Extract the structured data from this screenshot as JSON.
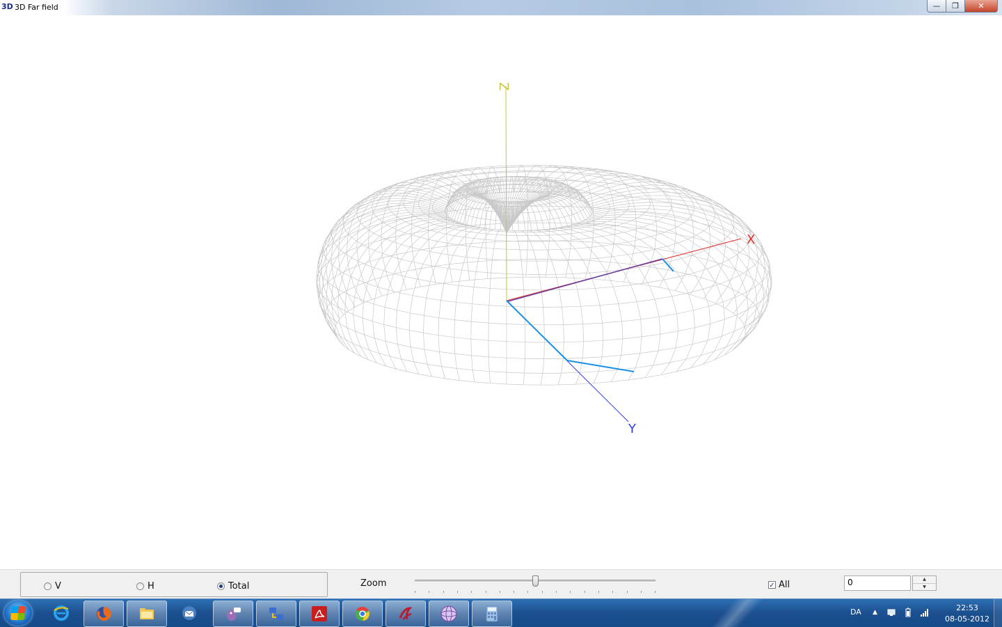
{
  "window": {
    "icon_text": "3D",
    "title": "3D Far field",
    "controls": {
      "minimize": "—",
      "maximize": "❐",
      "close": "✕"
    }
  },
  "viewport": {
    "axes": {
      "x_label": "X",
      "y_label": "Y",
      "z_label": "Z"
    },
    "colors": {
      "mesh": "#c8c8c8",
      "x_axis": "#e23030",
      "y_axis": "#2a3cf0",
      "z_axis": "#c8c832",
      "aux": "#1a8fe6"
    }
  },
  "controls": {
    "radios": [
      {
        "label": "V",
        "checked": false
      },
      {
        "label": "H",
        "checked": false
      },
      {
        "label": "Total",
        "checked": true
      }
    ],
    "zoom_label": "Zoom",
    "zoom_value": 0.5,
    "all_label": "All",
    "all_checked": true,
    "spin_value": "0"
  },
  "taskbar": {
    "apps": [
      {
        "name": "internet-explorer",
        "icon": "ie-icon",
        "color": "#2aa3ef",
        "active": false
      },
      {
        "name": "firefox",
        "icon": "firefox-icon",
        "color": "#e86a1a",
        "active": true
      },
      {
        "name": "file-explorer",
        "icon": "folder-icon",
        "color": "#f2c94c",
        "active": true
      },
      {
        "name": "thunderbird",
        "icon": "thunderbird-icon",
        "color": "#4a7fc1",
        "active": false
      },
      {
        "name": "pidgin",
        "icon": "pidgin-icon",
        "color": "#9b6fb5",
        "active": true
      },
      {
        "name": "network-tool",
        "icon": "network-icon",
        "color": "#3b6ed1",
        "active": true
      },
      {
        "name": "adobe-reader",
        "icon": "pdf-icon",
        "color": "#c81e1e",
        "active": true
      },
      {
        "name": "chrome",
        "icon": "chrome-icon",
        "color": "#e7403a",
        "active": true
      },
      {
        "name": "antenna-tool",
        "icon": "antenna-icon",
        "color": "#b91c2c",
        "active": true
      },
      {
        "name": "farfield-app",
        "icon": "globe-icon",
        "color": "#d9c7ef",
        "active": true
      },
      {
        "name": "calculator",
        "icon": "calculator-icon",
        "color": "#9fc3e8",
        "active": true
      }
    ],
    "language": "DA",
    "time": "22:53",
    "date": "08-05-2012"
  }
}
